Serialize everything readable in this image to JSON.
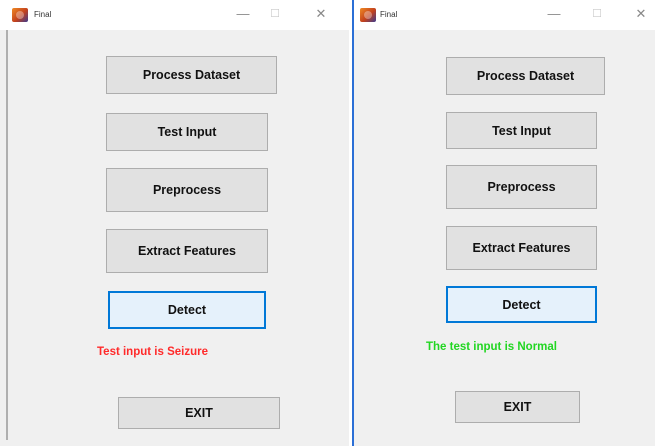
{
  "windows": [
    {
      "title": "Final",
      "buttons": {
        "process_dataset": "Process Dataset",
        "test_input": "Test Input",
        "preprocess": "Preprocess",
        "extract_features": "Extract Features",
        "detect": "Detect",
        "exit": "EXIT"
      },
      "result": {
        "text": "Test input is Seizure",
        "color": "#ff2a2a"
      }
    },
    {
      "title": "Final",
      "buttons": {
        "process_dataset": "Process Dataset",
        "test_input": "Test Input",
        "preprocess": "Preprocess",
        "extract_features": "Extract Features",
        "detect": "Detect",
        "exit": "EXIT"
      },
      "result": {
        "text": "The test input is Normal",
        "color": "#22d622"
      }
    }
  ],
  "title_bar_controls": {
    "minimize": "—",
    "maximize": "☐",
    "close": "✕"
  },
  "accent_color": "#0078d7"
}
